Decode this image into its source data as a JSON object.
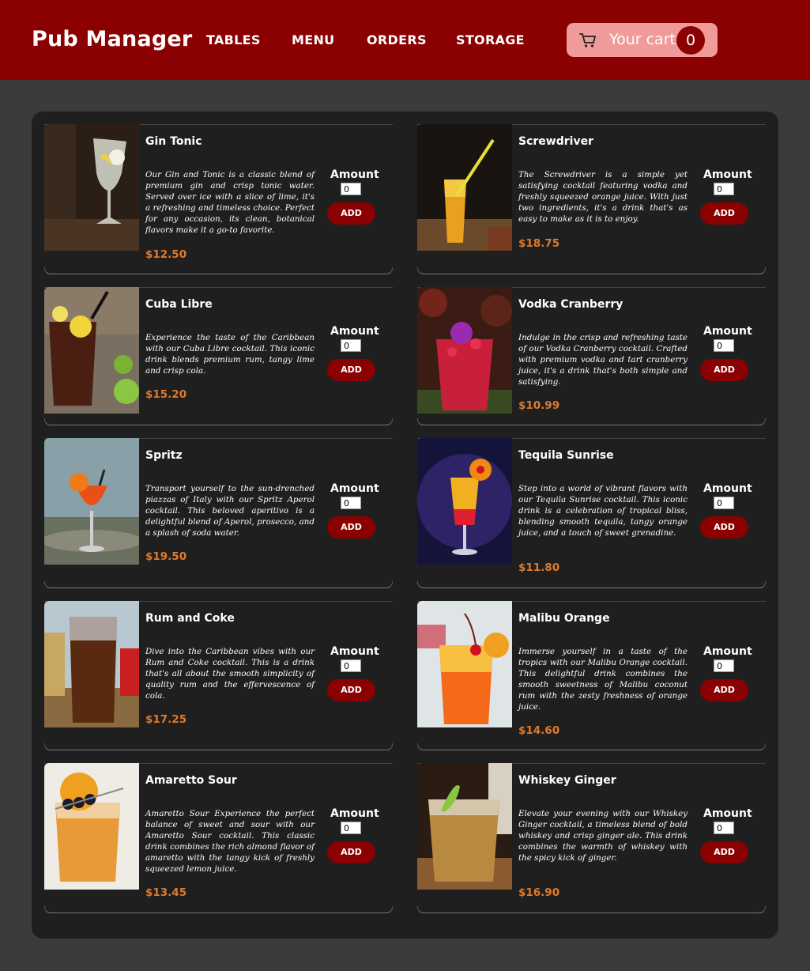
{
  "header": {
    "brand": "Pub Manager",
    "nav": [
      "TABLES",
      "MENU",
      "ORDERS",
      "STORAGE"
    ],
    "cart_label": "Your cart",
    "cart_count": "0",
    "cart_icon": "shopping-cart-icon",
    "colors": {
      "bar": "#8b0000",
      "cart_bg": "#f09a9a",
      "accent_price": "#e07a2c"
    }
  },
  "menu": {
    "amount_label": "Amount",
    "add_label": "ADD",
    "items": [
      {
        "name": "Gin Tonic",
        "description": "Our Gin and Tonic is a classic blend of premium gin and crisp tonic water. Served over ice with a slice of lime, it's a refreshing and timeless choice. Perfect for any occasion, its clean, botanical flavors make it a go-to favorite.",
        "price": "$12.50",
        "amount": "0"
      },
      {
        "name": "Screwdriver",
        "description": "The Screwdriver is a simple yet satisfying cocktail featuring vodka and freshly squeezed orange juice. With just two ingredients, it's a drink that's as easy to make as it is to enjoy.",
        "price": "$18.75",
        "amount": "0"
      },
      {
        "name": "Cuba Libre",
        "description": "Experience the taste of the Caribbean with our Cuba Libre cocktail. This iconic drink blends premium rum, tangy lime and crisp cola.",
        "price": "$15.20",
        "amount": "0"
      },
      {
        "name": "Vodka Cranberry",
        "description": "Indulge in the crisp and refreshing taste of our Vodka Cranberry cocktail. Crafted with premium vodka and tart cranberry juice, it's a drink that's both simple and satisfying.",
        "price": "$10.99",
        "amount": "0"
      },
      {
        "name": "Spritz",
        "description": "Transport yourself to the sun-drenched piazzas of Italy with our Spritz Aperol cocktail. This beloved aperitivo is a delightful blend of Aperol, prosecco, and a splash of soda water.",
        "price": "$19.50",
        "amount": "0"
      },
      {
        "name": "Tequila Sunrise",
        "description": "Step into a world of vibrant flavors with our Tequila Sunrise cocktail. This iconic drink is a celebration of tropical bliss, blending smooth tequila, tangy orange juice, and a touch of sweet grenadine.",
        "price": "$11.80",
        "amount": "0"
      },
      {
        "name": "Rum and Coke",
        "description": "Dive into the Caribbean vibes with our Rum and Coke cocktail. This is a drink that's all about the smooth simplicity of quality rum and the effervescence of cola.",
        "price": "$17.25",
        "amount": "0"
      },
      {
        "name": "Malibu Orange",
        "description": "Immerse yourself in a taste of the tropics with our Malibu Orange cocktail. This delightful drink combines the smooth sweetness of Malibu coconut rum with the zesty freshness of orange juice.",
        "price": "$14.60",
        "amount": "0"
      },
      {
        "name": "Amaretto Sour",
        "description": "Amaretto Sour Experience the perfect balance of sweet and sour with our Amaretto Sour cocktail. This classic drink combines the rich almond flavor of amaretto with the tangy kick of freshly squeezed lemon juice.",
        "price": "$13.45",
        "amount": "0"
      },
      {
        "name": "Whiskey Ginger",
        "description": "Elevate your evening with our Whiskey Ginger cocktail, a timeless blend of bold whiskey and crisp ginger ale. This drink combines the warmth of whiskey with the spicy kick of ginger.",
        "price": "$16.90",
        "amount": "0"
      }
    ]
  }
}
